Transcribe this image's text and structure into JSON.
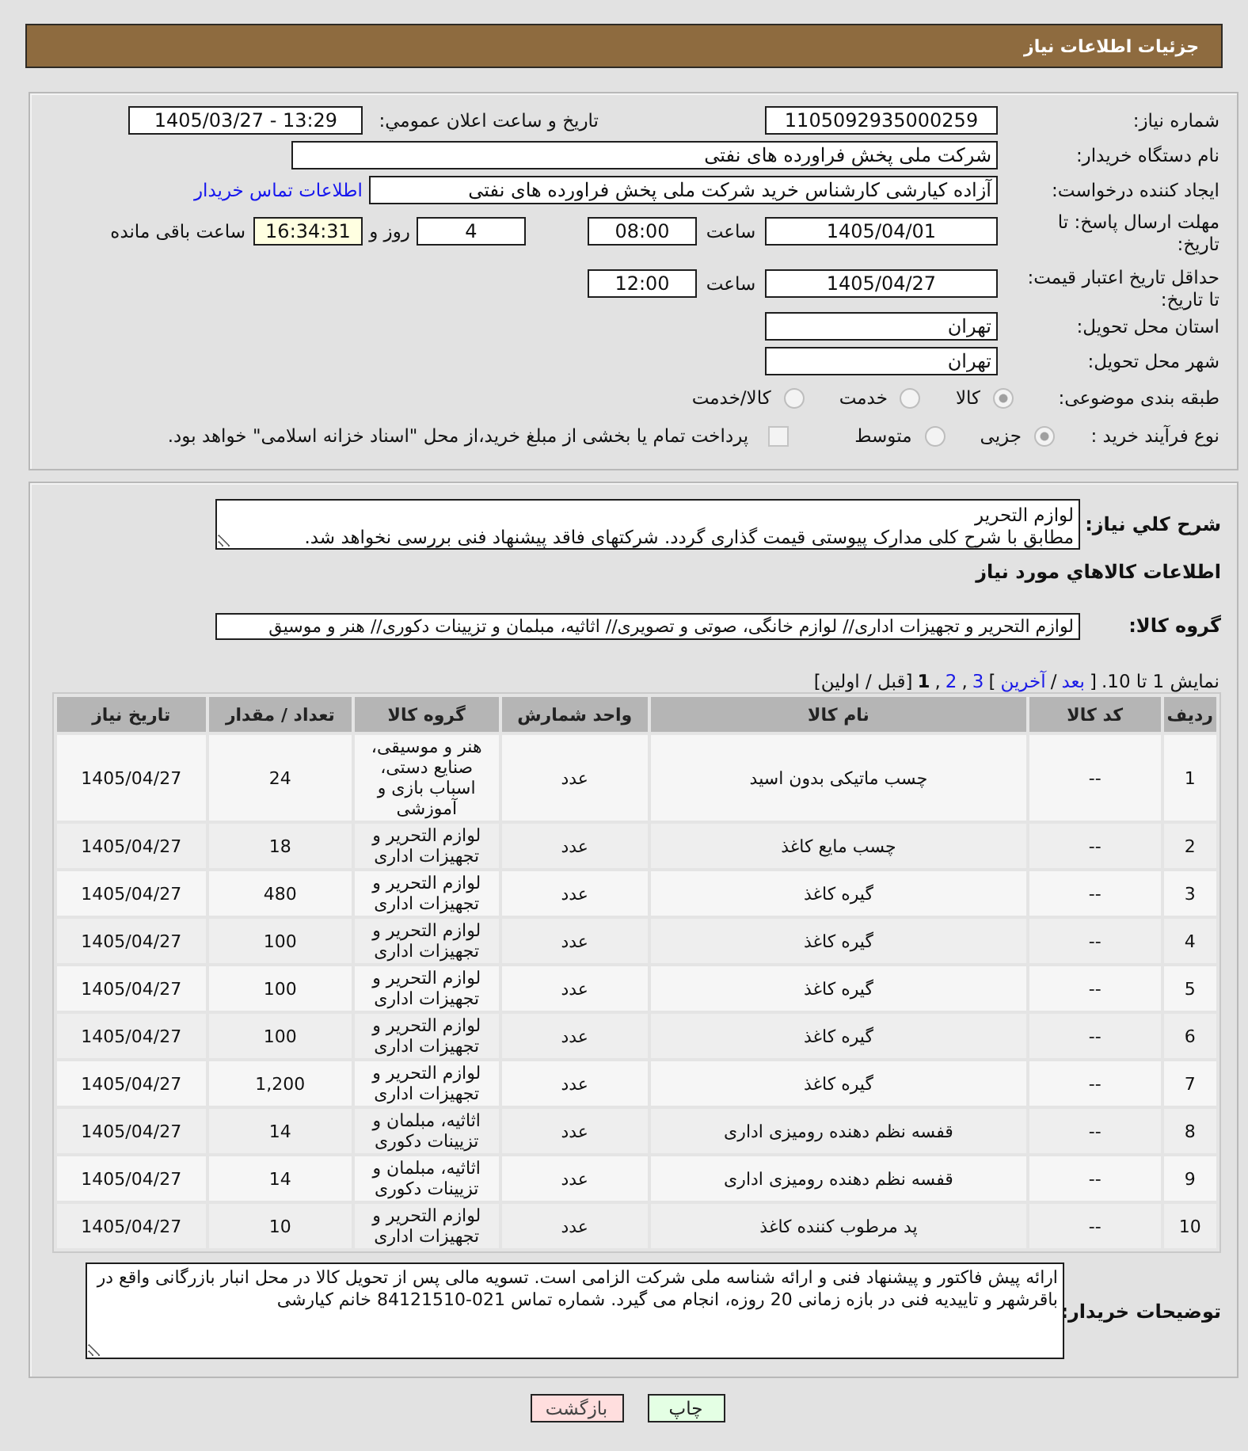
{
  "header": {
    "title": "جزئیات اطلاعات نیاز"
  },
  "need_info": {
    "need_number": {
      "label": "شماره نیاز:",
      "value": "1105092935000259"
    },
    "announce_datetime": {
      "label": "تاریخ و ساعت اعلان عمومي:",
      "value": "1405/03/27 - 13:29"
    },
    "buyer_org": {
      "label": "نام دستگاه خریدار:",
      "value": "شرکت ملی پخش فراورده های نفتی"
    },
    "requester": {
      "label": "ایجاد کننده درخواست:",
      "value": "آزاده کیارشی کارشناس خرید شرکت ملی پخش فراورده های نفتی",
      "link": "اطلاعات تماس خریدار"
    },
    "reply_deadline": {
      "label": "مهلت ارسال پاسخ: تا تاریخ:",
      "date": "1405/04/01",
      "time_label": "ساعت",
      "time": "08:00",
      "days": "4",
      "days_label": "روز و",
      "remaining": "16:34:31",
      "remaining_label": "ساعت باقی مانده"
    },
    "price_validity": {
      "label": "حداقل تاریخ اعتبار قیمت: تا تاریخ:",
      "date": "1405/04/27",
      "time_label": "ساعت",
      "time": "12:00"
    },
    "delivery_province": {
      "label": "استان محل تحویل:",
      "value": "تهران"
    },
    "delivery_city": {
      "label": "شهر محل تحویل:",
      "value": "تهران"
    },
    "subject_category": {
      "label": "طبقه بندی موضوعی:",
      "options": [
        {
          "label": "کالا",
          "selected": true
        },
        {
          "label": "خدمت",
          "selected": false
        },
        {
          "label": "کالا/خدمت",
          "selected": false
        }
      ]
    },
    "purchase_process": {
      "label": "نوع فرآیند خرید :",
      "options": [
        {
          "label": "جزیی",
          "selected": true
        },
        {
          "label": "متوسط",
          "selected": false
        }
      ],
      "treasury_payment": {
        "label": "پرداخت تمام یا بخشی از مبلغ خرید،از محل \"اسناد خزانه اسلامی\" خواهد بود.",
        "checked": false
      }
    }
  },
  "details": {
    "description": {
      "label": "شرح کلي نياز:",
      "value": "لوازم التحریر\nمطابق با شرح کلی مدارک پیوستی قیمت گذاری گردد. شرکتهای فاقد پیشنهاد فنی بررسی نخواهد شد."
    },
    "goods_heading": "اطلاعات کالاهاي مورد نياز",
    "goods_group": {
      "label": "گروه کالا:",
      "value": "لوازم التحریر و تجهیزات اداری// لوازم خانگی، صوتی و تصویری// اثاثیه، مبلمان و تزیینات دکوری// هنر و موسیق"
    },
    "pager": {
      "summary": "نمایش 1 تا 10.",
      "parts": [
        {
          "kind": "symbol",
          "text": "]"
        },
        {
          "kind": "link",
          "text": "بعد"
        },
        {
          "kind": "symbol",
          "text": "/"
        },
        {
          "kind": "link",
          "text": "آخرین"
        },
        {
          "kind": "symbol",
          "text": "["
        },
        {
          "kind": "page",
          "text": "3",
          "selected": false
        },
        {
          "kind": "symbol",
          "text": ","
        },
        {
          "kind": "page",
          "text": "2",
          "selected": false
        },
        {
          "kind": "symbol",
          "text": ","
        },
        {
          "kind": "page",
          "text": "1",
          "selected": true
        },
        {
          "kind": "text",
          "text": "[قبل / اولین]"
        }
      ]
    },
    "table": {
      "columns": [
        "ردیف",
        "کد کالا",
        "نام کالا",
        "واحد شمارش",
        "گروه کالا",
        "تعداد / مقدار",
        "تاریخ نیاز"
      ],
      "rows": [
        [
          "1",
          "--",
          "چسب ماتیکی بدون اسید",
          "عدد",
          "هنر و موسیقی، صنایع دستی، اسباب بازی و آموزشی",
          "24",
          "1405/04/27"
        ],
        [
          "2",
          "--",
          "چسب مایع کاغذ",
          "عدد",
          "لوازم التحریر و تجهیزات اداری",
          "18",
          "1405/04/27"
        ],
        [
          "3",
          "--",
          "گیره کاغذ",
          "عدد",
          "لوازم التحریر و تجهیزات اداری",
          "480",
          "1405/04/27"
        ],
        [
          "4",
          "--",
          "گیره کاغذ",
          "عدد",
          "لوازم التحریر و تجهیزات اداری",
          "100",
          "1405/04/27"
        ],
        [
          "5",
          "--",
          "گیره کاغذ",
          "عدد",
          "لوازم التحریر و تجهیزات اداری",
          "100",
          "1405/04/27"
        ],
        [
          "6",
          "--",
          "گیره کاغذ",
          "عدد",
          "لوازم التحریر و تجهیزات اداری",
          "100",
          "1405/04/27"
        ],
        [
          "7",
          "--",
          "گیره کاغذ",
          "عدد",
          "لوازم التحریر و تجهیزات اداری",
          "1,200",
          "1405/04/27"
        ],
        [
          "8",
          "--",
          "قفسه نظم دهنده رومیزی اداری",
          "عدد",
          "اثاثیه، مبلمان و تزیینات دکوری",
          "14",
          "1405/04/27"
        ],
        [
          "9",
          "--",
          "قفسه نظم دهنده رومیزی اداری",
          "عدد",
          "اثاثیه، مبلمان و تزیینات دکوری",
          "14",
          "1405/04/27"
        ],
        [
          "10",
          "--",
          "پد مرطوب کننده کاغذ",
          "عدد",
          "لوازم التحریر و تجهیزات اداری",
          "10",
          "1405/04/27"
        ]
      ]
    },
    "buyer_notes": {
      "label": "توضیحات خریدار:",
      "value": "ارائه پیش فاکتور و پیشنهاد فنی و ارائه شناسه ملی شرکت الزامی است. تسویه مالی پس از تحویل کالا در محل انبار بازرگانی واقع در باقرشهر و تاییدیه فنی در بازه زمانی 20 روزه، انجام می گیرد. شماره تماس 021-84121510 خانم کیارشی"
    }
  },
  "buttons": [
    {
      "kind": "print",
      "label": "چاپ"
    },
    {
      "kind": "back",
      "label": "بازگشت"
    }
  ]
}
